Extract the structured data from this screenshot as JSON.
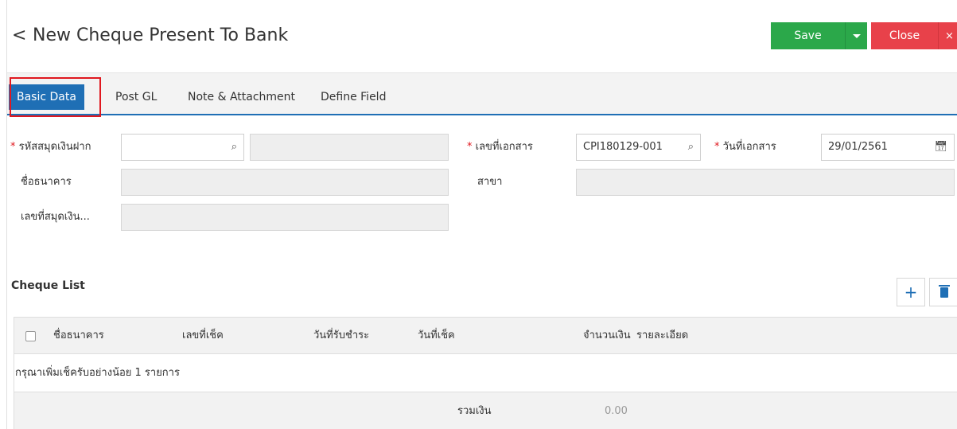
{
  "header": {
    "back_glyph": "<",
    "title": "New Cheque Present To Bank",
    "save_label": "Save",
    "close_label": "Close",
    "close_x": "×"
  },
  "tabs": [
    {
      "label": "Basic Data",
      "active": true
    },
    {
      "label": "Post GL",
      "active": false
    },
    {
      "label": "Note & Attachment",
      "active": false
    },
    {
      "label": "Define Field",
      "active": false
    }
  ],
  "form": {
    "deposit_book_code": {
      "label": "รหัสสมุดเงินฝาก",
      "required": true,
      "value": "",
      "name_value": ""
    },
    "doc_no": {
      "label": "เลขที่เอกสาร",
      "required": true,
      "value": "CPI180129-001"
    },
    "doc_date": {
      "label": "วันที่เอกสาร",
      "required": true,
      "value": "29/01/2561"
    },
    "bank_name": {
      "label": "ชื่อธนาคาร",
      "value": ""
    },
    "branch": {
      "label": "สาขา",
      "value": ""
    },
    "book_no": {
      "label": "เลขที่สมุดเงิน...",
      "value": ""
    }
  },
  "cheque_list": {
    "title": "Cheque List",
    "columns": [
      "ชื่อธนาคาร",
      "เลขที่เช็ค",
      "วันที่รับชำระ",
      "วันที่เช็ค",
      "จำนวนเงิน",
      "รายละเอียด"
    ],
    "empty_message": "กรุณาเพิ่มเช็ครับอย่างน้อย 1 รายการ",
    "total_label": "รวมเงิน",
    "total_value": "0.00"
  },
  "colors": {
    "primary": "#1f6fb5",
    "save": "#2ba84a",
    "close": "#e8414a",
    "required": "#e0181f"
  }
}
